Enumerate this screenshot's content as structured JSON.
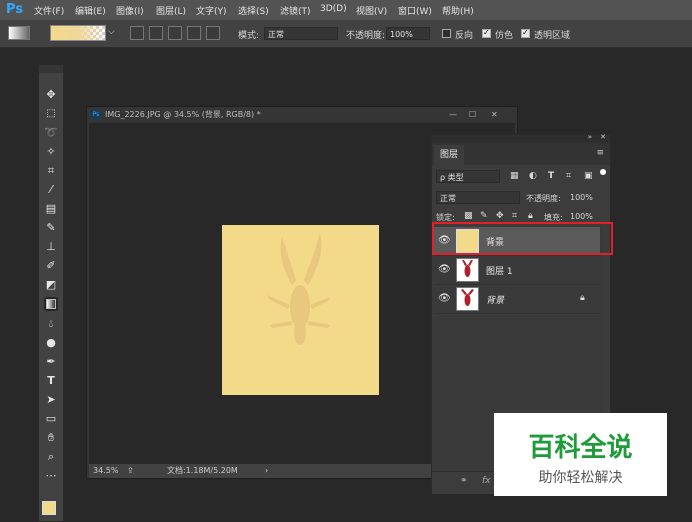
{
  "app": {
    "logo": "Ps"
  },
  "menu": [
    "文件(F)",
    "编辑(E)",
    "图像(I)",
    "图层(L)",
    "文字(Y)",
    "选择(S)",
    "滤镜(T)",
    "3D(D)",
    "视图(V)",
    "窗口(W)",
    "帮助(H)"
  ],
  "options": {
    "mode_label": "模式:",
    "mode_value": "正常",
    "opacity_label": "不透明度:",
    "opacity_value": "100%",
    "reverse_label": "反向",
    "dither_label": "仿色",
    "transparency_label": "透明区域"
  },
  "document": {
    "title": "IMG_2226.JPG @ 34.5% (背景, RGB/8) *",
    "zoom": "34.5%",
    "doc_info": "文档:1.18M/5.20M",
    "image_color": "#f3d98a"
  },
  "layers_panel": {
    "tab": "图层",
    "filter_kind": "ρ 类型",
    "blend_mode": "正常",
    "opacity_label": "不透明度:",
    "opacity_value": "100%",
    "lock_label": "锁定:",
    "fill_label": "填充:",
    "fill_value": "100%",
    "layers": [
      {
        "name": "背景",
        "selected": true,
        "thumb": "solid-yellow"
      },
      {
        "name": "图层 1",
        "selected": false,
        "thumb": "crawfish"
      },
      {
        "name": "背景",
        "selected": false,
        "thumb": "crawfish",
        "locked": true
      }
    ]
  },
  "watermark": {
    "title": "百科全说",
    "subtitle": "助你轻松解决"
  },
  "colors": {
    "accent": "#31a8ff",
    "highlight_box": "#e0202a",
    "foreground": "#f3d98a",
    "background": "#3fb54a"
  }
}
